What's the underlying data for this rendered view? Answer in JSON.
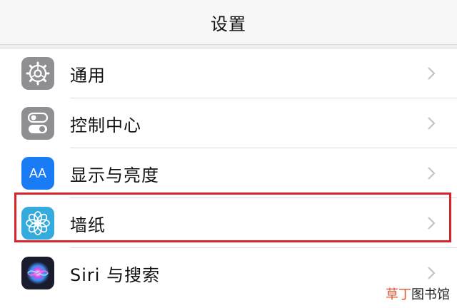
{
  "nav": {
    "title": "设置"
  },
  "rows": [
    {
      "label": "通用",
      "icon": "gear-icon",
      "icon_color": "#8e8e93"
    },
    {
      "label": "控制中心",
      "icon": "toggle-icon",
      "icon_color": "#8e8e93"
    },
    {
      "label": "显示与亮度",
      "icon": "text-size-icon",
      "icon_color": "#1a7cf5",
      "icon_text": "AA"
    },
    {
      "label": "墙纸",
      "icon": "flower-icon",
      "icon_color": "#35aadc"
    },
    {
      "label": "Siri 与搜索",
      "icon": "siri-icon",
      "icon_color": "#1b1b2e"
    }
  ],
  "highlight_color": "#d9232a",
  "watermark": {
    "accent": "草丁",
    "rest": "图书馆"
  }
}
